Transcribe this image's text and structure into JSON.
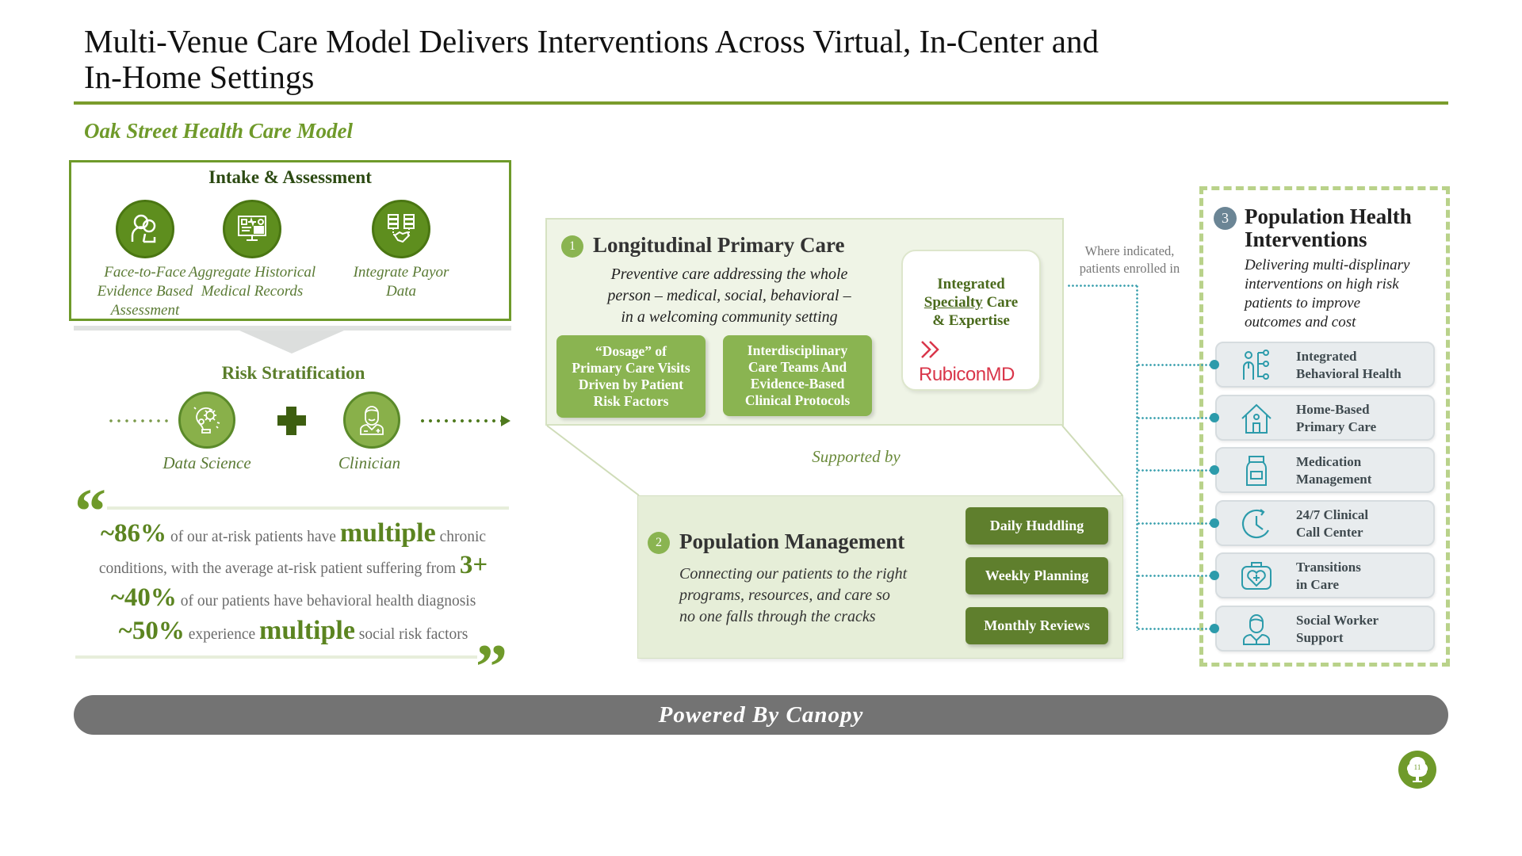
{
  "title": {
    "line1": "Multi-Venue Care Model Delivers Interventions Across Virtual, In-Center and",
    "line2": "In-Home Settings"
  },
  "subtitle": "Oak Street Health Care Model",
  "intake": {
    "title": "Intake & Assessment",
    "items": [
      {
        "icon": "people-icon",
        "label_lines": [
          "Face-to-Face",
          "Evidence Based",
          "Assessment"
        ]
      },
      {
        "icon": "medical-records-monitor-icon",
        "label_lines": [
          "Aggregate Historical",
          "Medical Records"
        ]
      },
      {
        "icon": "database-handshake-icon",
        "label_lines": [
          "Integrate Payor",
          "Data"
        ]
      }
    ]
  },
  "risk": {
    "title": "Risk Stratification",
    "items": [
      {
        "icon": "lightbulb-gears-icon",
        "label": "Data Science"
      },
      {
        "icon": "doctor-icon",
        "label": "Clinician"
      }
    ]
  },
  "quote": {
    "open_mark": "“",
    "close_mark": "”",
    "line1": {
      "stat": "~86%",
      "pre": " of our at-risk patients have ",
      "emph": "multiple",
      "post": " chronic"
    },
    "line2": {
      "text": "conditions, with the average at-risk patient suffering from ",
      "stat": "3+"
    },
    "line3": {
      "stat": "~40%",
      "text": " of our patients have behavioral health diagnosis"
    },
    "line4": {
      "stat": "~50%",
      "pre": " experience ",
      "emph": "multiple",
      "post": " social risk factors"
    }
  },
  "lpc": {
    "number": "1",
    "title": "Longitudinal Primary Care",
    "desc_lines": [
      "Preventive care addressing the whole",
      "person – medical, social, behavioral –",
      "in a welcoming community setting"
    ],
    "boxes": [
      {
        "lines": [
          "“Dosage” of",
          "Primary Care Visits",
          "Driven by Patient",
          "Risk Factors"
        ]
      },
      {
        "lines": [
          "Interdisciplinary",
          "Care Teams And",
          "Evidence-Based",
          "Clinical Protocols"
        ]
      }
    ],
    "specialty": {
      "line1": "Integrated",
      "line2_u": "Specialty",
      "line2_rest": " Care",
      "line3": "& Expertise",
      "partner": "RubiconMD",
      "partner_color": "#d9364a"
    }
  },
  "where_indicated": [
    "Where indicated,",
    "patients enrolled in"
  ],
  "supported_by": "Supported by",
  "popm": {
    "number": "2",
    "title": "Population Management",
    "desc_lines": [
      "Connecting our patients to the right",
      "programs, resources, and care so",
      "no one falls through the cracks"
    ],
    "buttons": [
      "Daily Huddling",
      "Weekly Planning",
      "Monthly Reviews"
    ]
  },
  "interventions": {
    "number": "3",
    "title_lines": [
      "Population Health",
      "Interventions"
    ],
    "desc_lines": [
      "Delivering multi-displinary",
      "interventions on high risk",
      "patients to improve",
      "outcomes and cost"
    ],
    "items": [
      {
        "icon": "behavioral-health-icon",
        "lines": [
          "Integrated",
          "Behavioral Health"
        ]
      },
      {
        "icon": "home-icon",
        "lines": [
          "Home-Based",
          "Primary Care"
        ]
      },
      {
        "icon": "medication-bottle-icon",
        "lines": [
          "Medication",
          "Management"
        ]
      },
      {
        "icon": "clock-icon",
        "lines": [
          "24/7 Clinical",
          "Call Center"
        ]
      },
      {
        "icon": "medical-kit-icon",
        "lines": [
          "Transitions",
          "in Care"
        ]
      },
      {
        "icon": "social-worker-icon",
        "lines": [
          "Social Worker",
          "Support"
        ]
      }
    ]
  },
  "footer": "Powered By Canopy",
  "page_number": "11",
  "colors": {
    "brand_green": "#6f9a2a",
    "dark_green": "#5f7f2d",
    "light_green": "#8ab451",
    "teal": "#2c9bab",
    "footer_gray": "#737373"
  }
}
